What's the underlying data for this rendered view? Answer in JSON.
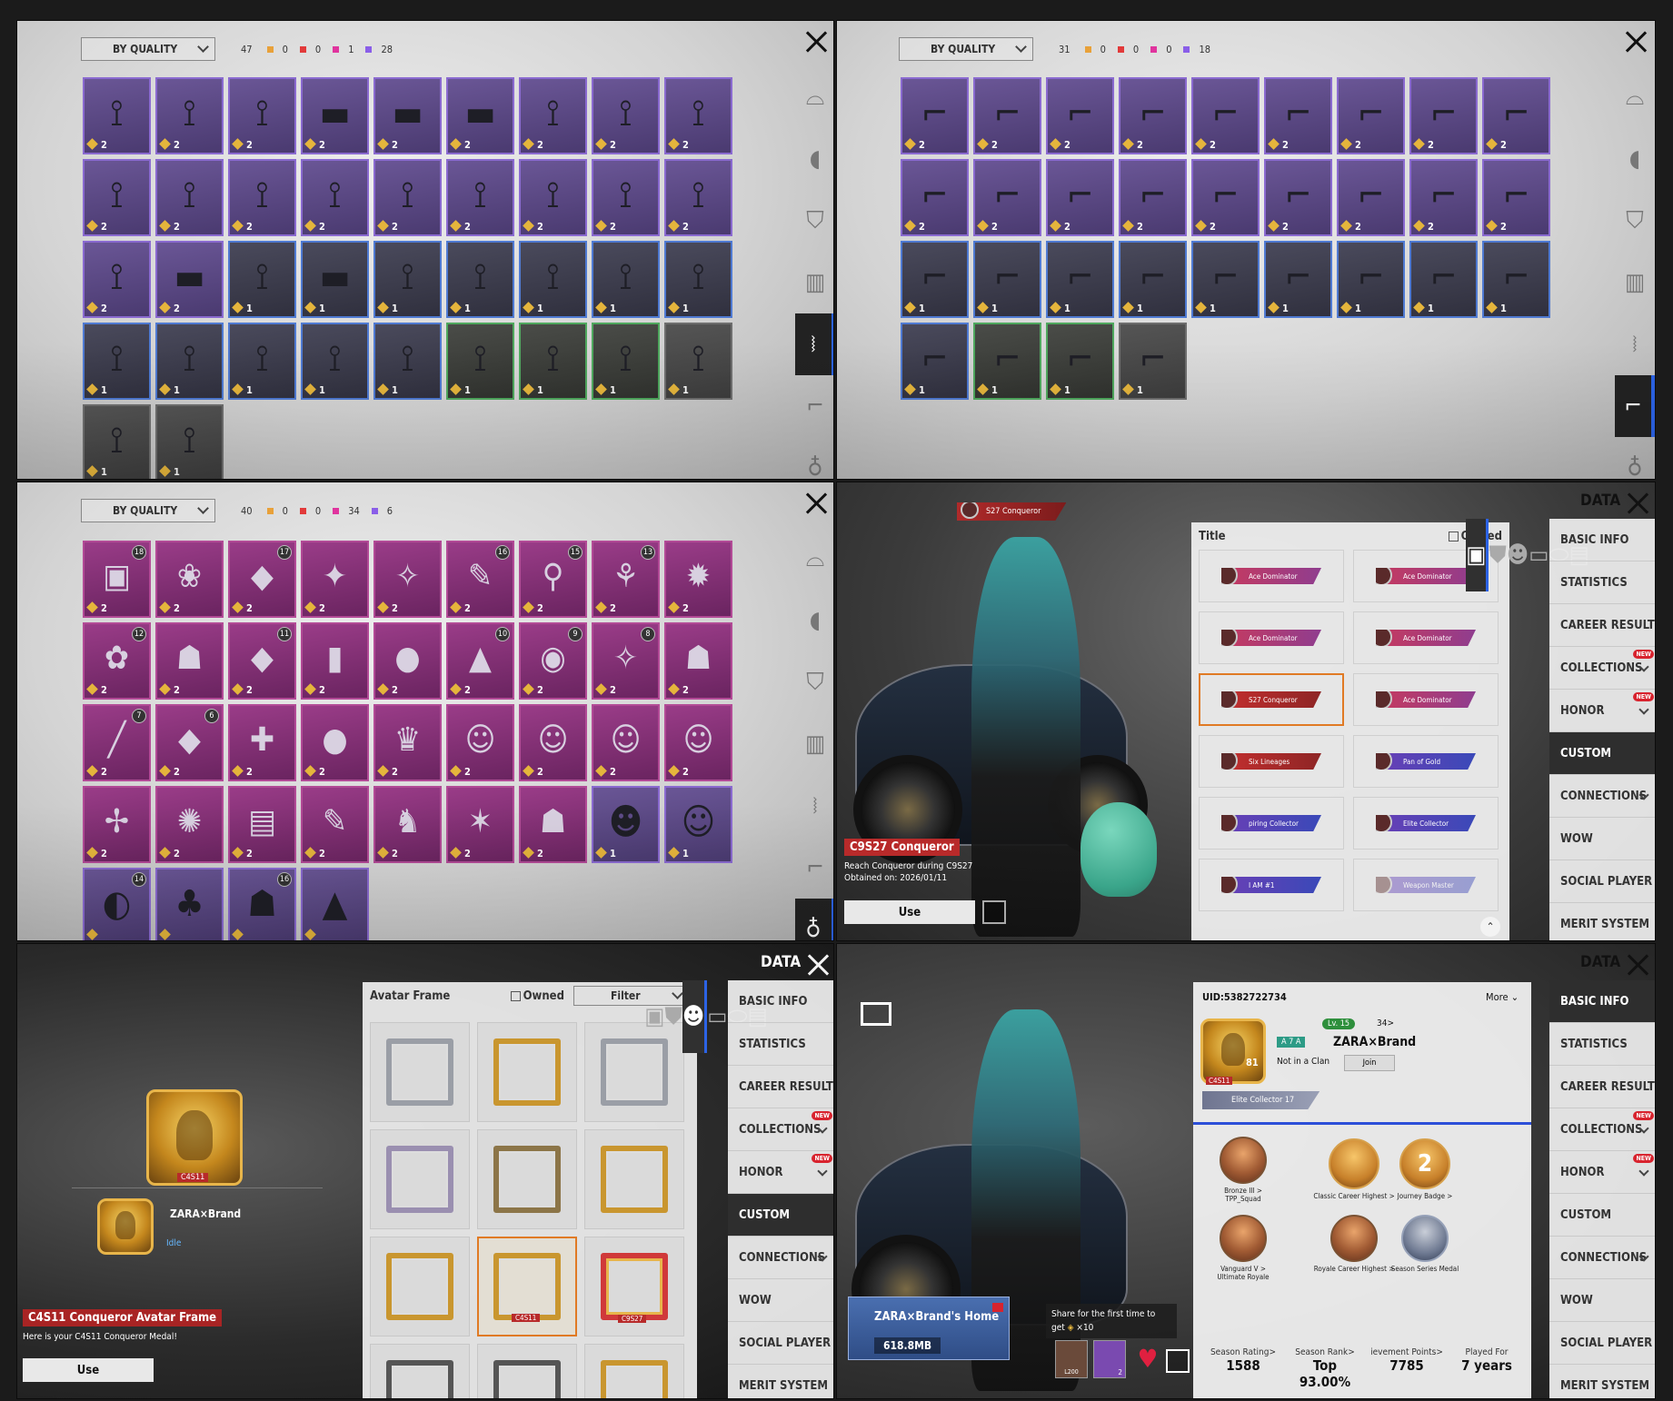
{
  "common": {
    "sort_label": "BY QUALITY",
    "data_label": "DATA",
    "use_label": "Use",
    "owned_label": "Owned",
    "filter_label": "Filter"
  },
  "colors": {
    "quality_orange": "#e8a13a",
    "quality_red": "#e23a3a",
    "quality_pink": "#e0349e",
    "quality_purple": "#8a5ee8",
    "selected_border": "#e07a24",
    "active_blue": "#2c63e5"
  },
  "category_icons": [
    "glasses-icon",
    "mask-icon",
    "jacket-icon",
    "backpack-icon",
    "pants-icon",
    "shoes-icon",
    "pendant-icon"
  ],
  "pants_panel": {
    "count": "47",
    "quality_counts": [
      "0",
      "0",
      "1",
      "28"
    ],
    "items": [
      {
        "q": "purple",
        "n": "2",
        "g": "⟟"
      },
      {
        "q": "purple",
        "n": "2",
        "g": "⟟"
      },
      {
        "q": "purple",
        "n": "2",
        "g": "⟟"
      },
      {
        "q": "purple",
        "n": "2",
        "g": "▬"
      },
      {
        "q": "purple",
        "n": "2",
        "g": "▬"
      },
      {
        "q": "purple",
        "n": "2",
        "g": "▬"
      },
      {
        "q": "purple",
        "n": "2",
        "g": "⟟"
      },
      {
        "q": "purple",
        "n": "2",
        "g": "⟟"
      },
      {
        "q": "purple",
        "n": "2",
        "g": "⟟"
      },
      {
        "q": "purple",
        "n": "2",
        "g": "⟟"
      },
      {
        "q": "purple",
        "n": "2",
        "g": "⟟"
      },
      {
        "q": "purple",
        "n": "2",
        "g": "⟟"
      },
      {
        "q": "purple",
        "n": "2",
        "g": "⟟"
      },
      {
        "q": "purple",
        "n": "2",
        "g": "⟟"
      },
      {
        "q": "purple",
        "n": "2",
        "g": "⟟"
      },
      {
        "q": "purple",
        "n": "2",
        "g": "⟟"
      },
      {
        "q": "purple",
        "n": "2",
        "g": "⟟"
      },
      {
        "q": "purple",
        "n": "2",
        "g": "⟟"
      },
      {
        "q": "purple",
        "n": "2",
        "g": "⟟"
      },
      {
        "q": "purple",
        "n": "2",
        "g": "▬"
      },
      {
        "q": "blue",
        "n": "1",
        "g": "⟟"
      },
      {
        "q": "blue",
        "n": "1",
        "g": "▬"
      },
      {
        "q": "blue",
        "n": "1",
        "g": "⟟"
      },
      {
        "q": "blue",
        "n": "1",
        "g": "⟟"
      },
      {
        "q": "blue",
        "n": "1",
        "g": "⟟"
      },
      {
        "q": "blue",
        "n": "1",
        "g": "⟟"
      },
      {
        "q": "blue",
        "n": "1",
        "g": "⟟"
      },
      {
        "q": "blue",
        "n": "1",
        "g": "⟟"
      },
      {
        "q": "blue",
        "n": "1",
        "g": "⟟"
      },
      {
        "q": "blue",
        "n": "1",
        "g": "⟟"
      },
      {
        "q": "blue",
        "n": "1",
        "g": "⟟"
      },
      {
        "q": "blue",
        "n": "1",
        "g": "⟟"
      },
      {
        "q": "green",
        "n": "1",
        "g": "⟟"
      },
      {
        "q": "green",
        "n": "1",
        "g": "⟟"
      },
      {
        "q": "green",
        "n": "1",
        "g": "⟟"
      },
      {
        "q": "gray",
        "n": "1",
        "g": "⟟"
      },
      {
        "q": "gray",
        "n": "1",
        "g": "⟟"
      },
      {
        "q": "gray",
        "n": "1",
        "g": "⟟"
      }
    ]
  },
  "shoes_panel": {
    "count": "31",
    "quality_counts": [
      "0",
      "0",
      "0",
      "18"
    ],
    "items": [
      {
        "q": "purple",
        "n": "2",
        "g": "⌐"
      },
      {
        "q": "purple",
        "n": "2",
        "g": "⌐"
      },
      {
        "q": "purple",
        "n": "2",
        "g": "⌐"
      },
      {
        "q": "purple",
        "n": "2",
        "g": "⌐"
      },
      {
        "q": "purple",
        "n": "2",
        "g": "⌐"
      },
      {
        "q": "purple",
        "n": "2",
        "g": "⌐"
      },
      {
        "q": "purple",
        "n": "2",
        "g": "⌐"
      },
      {
        "q": "purple",
        "n": "2",
        "g": "⌐"
      },
      {
        "q": "purple",
        "n": "2",
        "g": "⌐"
      },
      {
        "q": "purple",
        "n": "2",
        "g": "⌐"
      },
      {
        "q": "purple",
        "n": "2",
        "g": "⌐"
      },
      {
        "q": "purple",
        "n": "2",
        "g": "⌐"
      },
      {
        "q": "purple",
        "n": "2",
        "g": "⌐"
      },
      {
        "q": "purple",
        "n": "2",
        "g": "⌐"
      },
      {
        "q": "purple",
        "n": "2",
        "g": "⌐"
      },
      {
        "q": "purple",
        "n": "2",
        "g": "⌐"
      },
      {
        "q": "purple",
        "n": "2",
        "g": "⌐"
      },
      {
        "q": "purple",
        "n": "2",
        "g": "⌐"
      },
      {
        "q": "blue",
        "n": "1",
        "g": "⌐"
      },
      {
        "q": "blue",
        "n": "1",
        "g": "⌐"
      },
      {
        "q": "blue",
        "n": "1",
        "g": "⌐"
      },
      {
        "q": "blue",
        "n": "1",
        "g": "⌐"
      },
      {
        "q": "blue",
        "n": "1",
        "g": "⌐"
      },
      {
        "q": "blue",
        "n": "1",
        "g": "⌐"
      },
      {
        "q": "blue",
        "n": "1",
        "g": "⌐"
      },
      {
        "q": "blue",
        "n": "1",
        "g": "⌐"
      },
      {
        "q": "blue",
        "n": "1",
        "g": "⌐"
      },
      {
        "q": "blue",
        "n": "1",
        "g": "⌐"
      },
      {
        "q": "green",
        "n": "1",
        "g": "⌐"
      },
      {
        "q": "green",
        "n": "1",
        "g": "⌐"
      },
      {
        "q": "gray",
        "n": "1",
        "g": "⌐"
      }
    ]
  },
  "pendant_panel": {
    "count": "40",
    "quality_counts": [
      "0",
      "0",
      "34",
      "6"
    ],
    "items": [
      {
        "q": "pink",
        "n": "2",
        "g": "▣",
        "l": "18"
      },
      {
        "q": "pink",
        "n": "2",
        "g": "❀",
        "l": ""
      },
      {
        "q": "pink",
        "n": "2",
        "g": "◆",
        "l": "17"
      },
      {
        "q": "pink",
        "n": "2",
        "g": "✦",
        "l": ""
      },
      {
        "q": "pink",
        "n": "2",
        "g": "✧",
        "l": ""
      },
      {
        "q": "pink",
        "n": "2",
        "g": "✎",
        "l": "16"
      },
      {
        "q": "pink",
        "n": "2",
        "g": "⚲",
        "l": "15"
      },
      {
        "q": "pink",
        "n": "2",
        "g": "⚘",
        "l": "13"
      },
      {
        "q": "pink",
        "n": "2",
        "g": "✹",
        "l": ""
      },
      {
        "q": "pink",
        "n": "2",
        "g": "✿",
        "l": "12"
      },
      {
        "q": "pink",
        "n": "2",
        "g": "☗",
        "l": ""
      },
      {
        "q": "pink",
        "n": "2",
        "g": "◆",
        "l": "11"
      },
      {
        "q": "pink",
        "n": "2",
        "g": "▮",
        "l": ""
      },
      {
        "q": "pink",
        "n": "2",
        "g": "●",
        "l": ""
      },
      {
        "q": "pink",
        "n": "2",
        "g": "▲",
        "l": "10"
      },
      {
        "q": "pink",
        "n": "2",
        "g": "◉",
        "l": "9"
      },
      {
        "q": "pink",
        "n": "2",
        "g": "✧",
        "l": "8"
      },
      {
        "q": "pink",
        "n": "2",
        "g": "☗",
        "l": ""
      },
      {
        "q": "pink",
        "n": "2",
        "g": "╱",
        "l": "7"
      },
      {
        "q": "pink",
        "n": "2",
        "g": "◆",
        "l": "6"
      },
      {
        "q": "pink",
        "n": "2",
        "g": "✚",
        "l": ""
      },
      {
        "q": "pink",
        "n": "2",
        "g": "●",
        "l": ""
      },
      {
        "q": "pink",
        "n": "2",
        "g": "♛",
        "l": ""
      },
      {
        "q": "pink",
        "n": "2",
        "g": "☺",
        "l": ""
      },
      {
        "q": "pink",
        "n": "2",
        "g": "☺",
        "l": ""
      },
      {
        "q": "pink",
        "n": "2",
        "g": "☺",
        "l": ""
      },
      {
        "q": "pink",
        "n": "2",
        "g": "☺",
        "l": ""
      },
      {
        "q": "pink",
        "n": "2",
        "g": "✢",
        "l": ""
      },
      {
        "q": "pink",
        "n": "2",
        "g": "✺",
        "l": ""
      },
      {
        "q": "pink",
        "n": "2",
        "g": "▤",
        "l": ""
      },
      {
        "q": "pink",
        "n": "2",
        "g": "✎",
        "l": ""
      },
      {
        "q": "pink",
        "n": "2",
        "g": "♞",
        "l": ""
      },
      {
        "q": "pink",
        "n": "2",
        "g": "✶",
        "l": ""
      },
      {
        "q": "pink",
        "n": "2",
        "g": "☗",
        "l": ""
      },
      {
        "q": "purple",
        "n": "1",
        "g": "☻",
        "l": ""
      },
      {
        "q": "purple",
        "n": "1",
        "g": "☺",
        "l": ""
      },
      {
        "q": "purple",
        "n": "",
        "g": "◐",
        "l": "14"
      },
      {
        "q": "purple",
        "n": "",
        "g": "♣",
        "l": ""
      },
      {
        "q": "purple",
        "n": "",
        "g": "☗",
        "l": "16"
      },
      {
        "q": "purple",
        "n": "",
        "g": "▲",
        "l": ""
      }
    ]
  },
  "nav": {
    "items": [
      {
        "label": "BASIC INFO",
        "new": false,
        "chev": false
      },
      {
        "label": "STATISTICS",
        "new": false,
        "chev": false
      },
      {
        "label": "CAREER RESULTS",
        "new": false,
        "chev": false
      },
      {
        "label": "COLLECTIONS",
        "new": true,
        "chev": true
      },
      {
        "label": "HONOR",
        "new": true,
        "chev": true
      },
      {
        "label": "CUSTOM",
        "new": false,
        "chev": false
      },
      {
        "label": "CONNECTIONS",
        "new": false,
        "chev": true
      },
      {
        "label": "WOW",
        "new": false,
        "chev": false
      },
      {
        "label": "SOCIAL PLAYER CARD",
        "new": false,
        "chev": false
      },
      {
        "label": "MERIT SYSTEM",
        "new": false,
        "chev": false
      }
    ],
    "new_badge": "NEW"
  },
  "title_panel": {
    "header": "Title",
    "top_badge": "S27 Conqueror",
    "titles": [
      {
        "label": "Ace Dominator",
        "style": "purple",
        "sel": false
      },
      {
        "label": "Ace Dominator",
        "style": "purple",
        "sel": false
      },
      {
        "label": "Ace Dominator",
        "style": "purple",
        "sel": false
      },
      {
        "label": "Ace Dominator",
        "style": "purple",
        "sel": false
      },
      {
        "label": "S27 Conqueror",
        "style": "red",
        "sel": true
      },
      {
        "label": "Ace Dominator",
        "style": "purple",
        "sel": false
      },
      {
        "label": "Six Lineages",
        "style": "red",
        "sel": false
      },
      {
        "label": "Pan of Gold",
        "style": "blue",
        "sel": false
      },
      {
        "label": "piring Collector",
        "style": "blue",
        "sel": false
      },
      {
        "label": "Elite Collector",
        "style": "blue",
        "sel": false
      },
      {
        "label": "I AM #1",
        "style": "blue",
        "sel": false
      },
      {
        "label": "Weapon Master",
        "style": "dim",
        "sel": false
      }
    ],
    "info_title": "C9S27 Conqueror",
    "info_desc": "Reach Conqueror during C9S27",
    "info_obtained": "Obtained on: 2026/01/11"
  },
  "frame_panel": {
    "header": "Avatar Frame",
    "medal_label": "C4S11",
    "player_name": "ZARA×Brand",
    "player_status": "Idle",
    "info_title": "C4S11 Conqueror Avatar Frame",
    "info_desc": "Here is your C4S11 Conqueror Medal!",
    "frames": [
      {
        "style": "silver",
        "sel": false
      },
      {
        "style": "gold",
        "sel": false
      },
      {
        "style": "silver",
        "sel": false
      },
      {
        "style": "purple",
        "sel": false
      },
      {
        "style": "bronze",
        "sel": false
      },
      {
        "style": "gold",
        "sel": false
      },
      {
        "style": "gold",
        "sel": false
      },
      {
        "style": "gold",
        "sel": true
      },
      {
        "style": "red",
        "sel": false
      },
      {
        "style": "dark",
        "sel": false
      },
      {
        "style": "dark",
        "sel": false
      },
      {
        "style": "gold",
        "sel": false
      }
    ],
    "frame_labels": [
      "",
      "",
      "",
      "",
      "",
      "",
      "",
      "C4S11",
      "C9S27",
      "",
      "",
      ""
    ]
  },
  "basic_panel": {
    "uid": "UID:5382722734",
    "more": "More",
    "level": "Lv. 15",
    "friends": "34>",
    "tag": "A 7 A",
    "name": "ZARA×Brand",
    "clan": "Not in a Clan",
    "join": "Join",
    "avatar_level": "81",
    "avatar_label": "C4S11",
    "badge_title": "Elite Collector 17",
    "ranks": [
      {
        "label": "Bronze III >",
        "sub": "TPP_Squad",
        "style": "bronze"
      },
      {
        "label": "Classic Career Highest >",
        "sub": "",
        "style": "gold"
      },
      {
        "label": "Journey Badge >",
        "sub": "",
        "style": "gold"
      },
      {
        "label": "Vanguard V >",
        "sub": "Ultimate Royale",
        "style": "bronze"
      },
      {
        "label": "Royale Career Highest >",
        "sub": "",
        "style": "bronze"
      },
      {
        "label": "Season Series Medal",
        "sub": "",
        "style": "sil"
      }
    ],
    "journey_num": "2",
    "stats": [
      {
        "label": "Season Rating>",
        "value": "1588"
      },
      {
        "label": "Season Rank>",
        "value": "Top 93.00%"
      },
      {
        "label": "ievement Points>",
        "value": "7785"
      },
      {
        "label": "Played For",
        "value": "7 years"
      }
    ],
    "home_title": "ZARA×Brand's Home",
    "home_size": "618.8MB",
    "home_level": "Lv.",
    "tip_text": "Share for the first time to",
    "tip_get": "get",
    "tip_count": "×10",
    "reward_nums": [
      "L200",
      "2"
    ]
  }
}
